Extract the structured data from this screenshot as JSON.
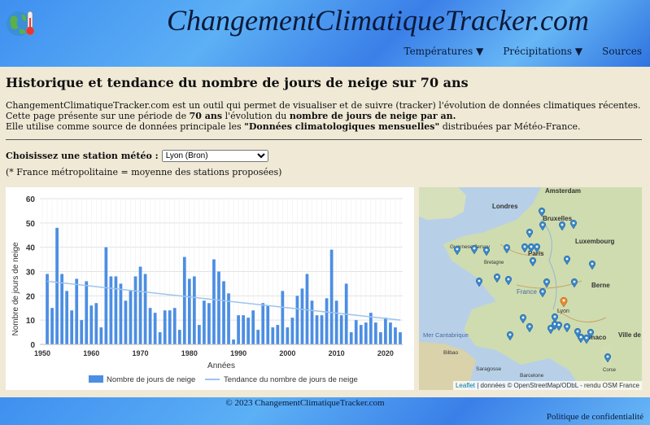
{
  "header": {
    "site_title": "ChangementClimatiqueTracker.com",
    "nav": [
      "Températures ▼",
      "Précipitations ▼",
      "Sources"
    ]
  },
  "main": {
    "title": "Historique et tendance du nombre de jours de neige sur 70 ans",
    "intro_line1": "ChangementClimatiqueTracker.com est un outil qui permet de visualiser et de suivre (tracker) l'évolution de données climatiques récentes.",
    "intro_line2_pre": "Cette page présente sur une période de ",
    "intro_line2_bold1": "70 ans",
    "intro_line2_mid": " l'évolution du ",
    "intro_line2_bold2": "nombre de jours de neige par an.",
    "intro_line3_pre": "Elle utilise comme source de données principale les ",
    "intro_line3_bold": "\"Données climatologiques mensuelles\"",
    "intro_line3_post": " distribuées par Météo-France.",
    "station_label": "Choisissez une station météo :",
    "station_selected": "Lyon (Bron)",
    "note": "(* France métropolitaine = moyenne des stations proposées)"
  },
  "chart_data": {
    "type": "bar",
    "x": [
      1951,
      1952,
      1953,
      1954,
      1955,
      1956,
      1957,
      1958,
      1959,
      1960,
      1961,
      1962,
      1963,
      1964,
      1965,
      1966,
      1967,
      1968,
      1969,
      1970,
      1971,
      1972,
      1973,
      1974,
      1975,
      1976,
      1977,
      1978,
      1979,
      1980,
      1981,
      1982,
      1983,
      1984,
      1985,
      1986,
      1987,
      1988,
      1989,
      1990,
      1991,
      1992,
      1993,
      1994,
      1995,
      1996,
      1997,
      1998,
      1999,
      2000,
      2001,
      2002,
      2003,
      2004,
      2005,
      2006,
      2007,
      2008,
      2009,
      2010,
      2011,
      2012,
      2013,
      2014,
      2015,
      2016,
      2017,
      2018,
      2019,
      2020,
      2021,
      2022,
      2023
    ],
    "series": [
      {
        "name": "Nombre de jours de neige",
        "values": [
          29,
          15,
          48,
          29,
          22,
          14,
          27,
          10,
          26,
          16,
          17,
          7,
          40,
          28,
          28,
          25,
          18,
          22,
          28,
          32,
          29,
          15,
          13,
          5,
          14,
          14,
          15,
          6,
          36,
          27,
          28,
          8,
          18,
          17,
          35,
          30,
          26,
          21,
          2,
          12,
          12,
          11,
          14,
          6,
          17,
          16,
          7,
          8,
          22,
          7,
          11,
          20,
          23,
          29,
          18,
          12,
          12,
          19,
          39,
          18,
          12,
          25,
          5,
          10,
          8,
          9,
          13,
          9,
          5,
          11,
          9,
          7,
          5
        ],
        "color": "#4c8ee3"
      },
      {
        "name": "Tendance du nombre de jours de neige",
        "values": [
          26,
          10
        ],
        "color": "#9bc4ee"
      }
    ],
    "xlabel": "Années",
    "ylabel": "Nombre de jours de neige",
    "ylim": [
      0,
      60
    ],
    "xticks": [
      1950,
      1960,
      1970,
      1980,
      1990,
      2000,
      2010,
      2020
    ],
    "yticks": [
      0,
      10,
      20,
      30,
      40,
      50,
      60
    ],
    "grid": true,
    "legend": "bottom"
  },
  "map": {
    "labels": [
      "Amsterdam",
      "Londres",
      "Bruxelles",
      "Luxembourg",
      "Paris",
      "Bretagne",
      "France",
      "Berne",
      "Lyon",
      "Monaco",
      "Ville de",
      "Mer Cantabrique",
      "Corse",
      "Barcelone",
      "Saragosse",
      "Bilbao",
      "Jersey",
      "Guernesey"
    ],
    "attribution_leaflet": "Leaflet",
    "attribution_rest": " | données © OpenStreetMap/ODbL - rendu OSM France"
  },
  "footer": {
    "copyright": "© 2023 ChangementClimatiqueTracker.com",
    "privacy": "Politique de confidentialité"
  },
  "colors": {
    "header_blue": "#3f8ff0",
    "page_bg": "#efe9d6",
    "bar": "#4c8ee3",
    "trend": "#9bc4ee",
    "marker": "#3a87c9",
    "marker_selected": "#e8892b"
  }
}
